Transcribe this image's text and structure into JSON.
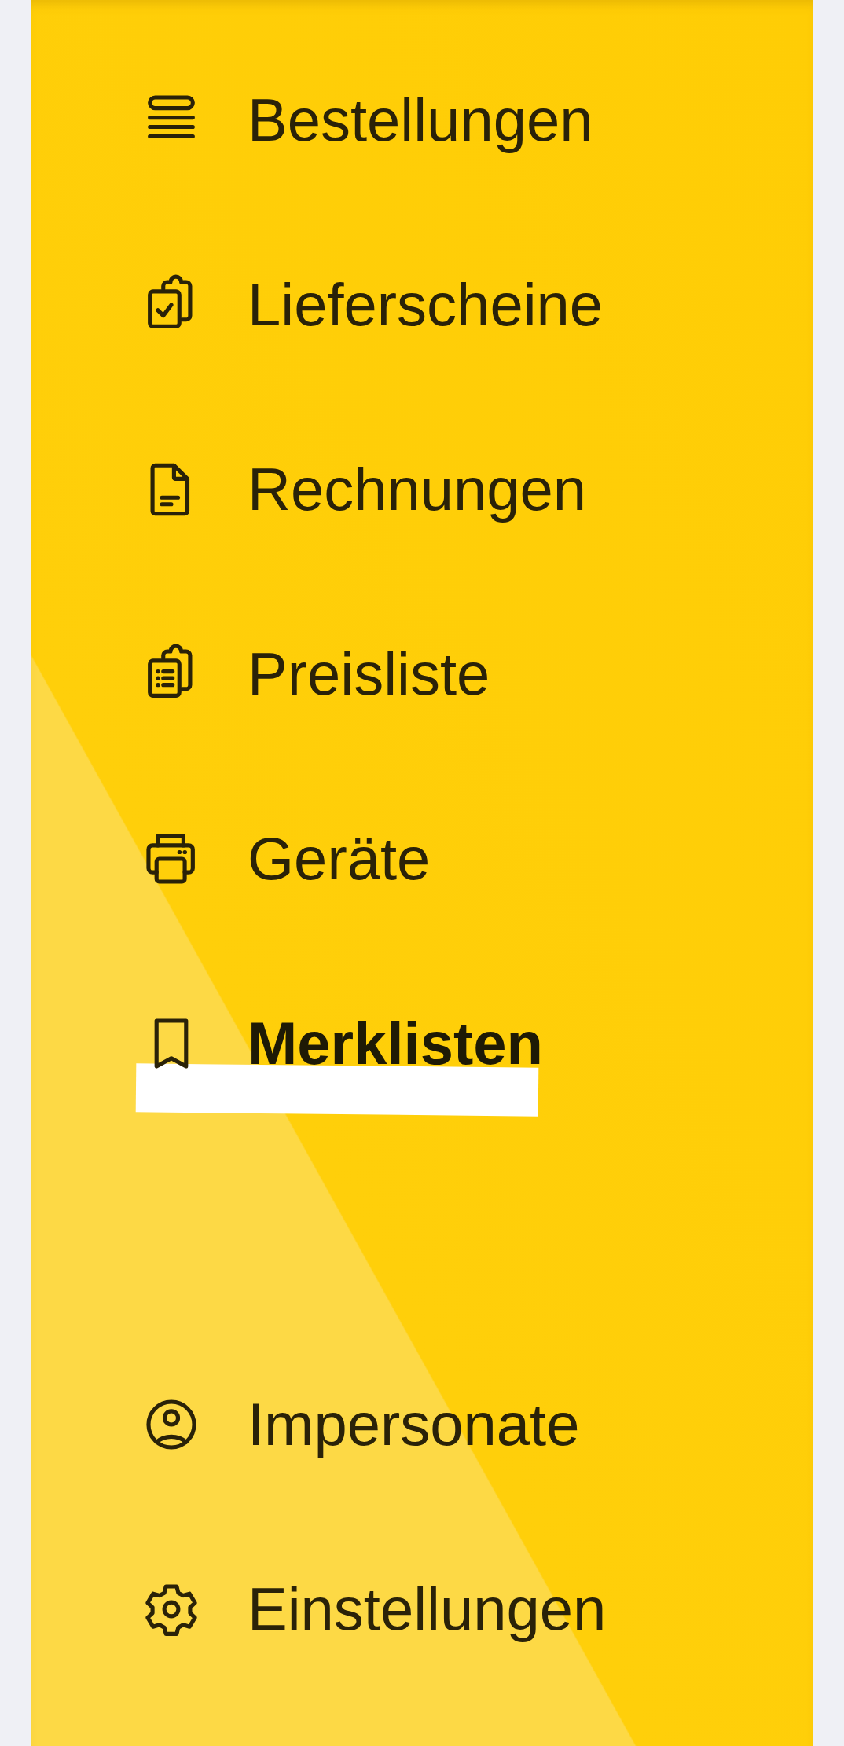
{
  "menu": {
    "items": [
      {
        "label": "Bestellungen",
        "selected": false
      },
      {
        "label": "Lieferscheine",
        "selected": false
      },
      {
        "label": "Rechnungen",
        "selected": false
      },
      {
        "label": "Preisliste",
        "selected": false
      },
      {
        "label": "Geräte",
        "selected": false
      },
      {
        "label": "Merklisten",
        "selected": true
      }
    ]
  },
  "footer_menu": {
    "items": [
      {
        "label": "Impersonate",
        "selected": false
      },
      {
        "label": "Einstellungen",
        "selected": false
      }
    ]
  }
}
